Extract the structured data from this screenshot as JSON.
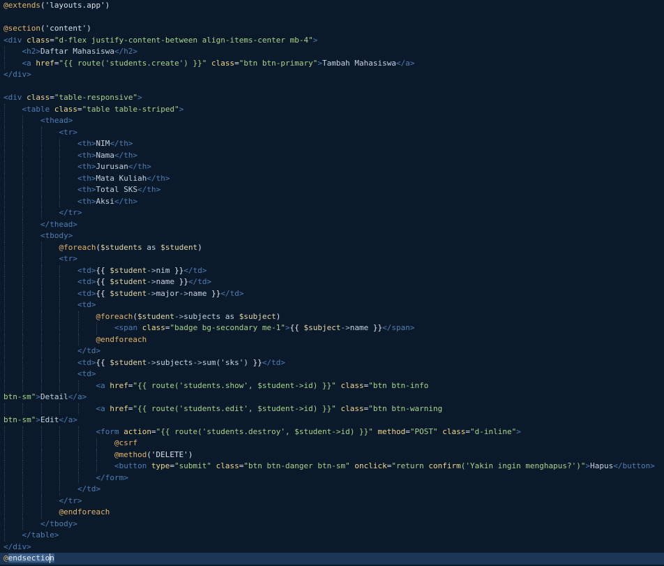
{
  "editor": {
    "colors": {
      "background": "#0b1a2b",
      "directive": "#e5b567",
      "tag": "#4d7fb5",
      "attribute": "#f0d78c",
      "string": "#a7d48a",
      "text": "#c7d2df",
      "current_line": "#1b3556"
    },
    "current_line_index": 48,
    "lines": [
      [
        [
          "directive",
          "@extends"
        ],
        [
          "punct",
          "('layouts.app')"
        ]
      ],
      [],
      [
        [
          "directive",
          "@section"
        ],
        [
          "punct",
          "('content')"
        ]
      ],
      [
        [
          "tag",
          "<div"
        ],
        [
          "text",
          " "
        ],
        [
          "attr",
          "class"
        ],
        [
          "punct",
          "="
        ],
        [
          "str",
          "\"d-flex justify-content-between align-items-center mb-4\""
        ],
        [
          "tag",
          ">"
        ]
      ],
      [
        [
          "text",
          "    "
        ],
        [
          "tag",
          "<h2>"
        ],
        [
          "text",
          "Daftar Mahasiswa"
        ],
        [
          "tag",
          "</h2>"
        ]
      ],
      [
        [
          "text",
          "    "
        ],
        [
          "tag",
          "<a"
        ],
        [
          "text",
          " "
        ],
        [
          "attr",
          "href"
        ],
        [
          "punct",
          "="
        ],
        [
          "str",
          "\"{{ route('students.create') }}\""
        ],
        [
          "text",
          " "
        ],
        [
          "attr",
          "class"
        ],
        [
          "punct",
          "="
        ],
        [
          "str",
          "\"btn btn-primary\""
        ],
        [
          "tag",
          ">"
        ],
        [
          "text",
          "Tambah Mahasiswa"
        ],
        [
          "tag",
          "</a>"
        ]
      ],
      [
        [
          "tag",
          "</div>"
        ]
      ],
      [],
      [
        [
          "tag",
          "<div"
        ],
        [
          "text",
          " "
        ],
        [
          "attr",
          "class"
        ],
        [
          "punct",
          "="
        ],
        [
          "str",
          "\"table-responsive\""
        ],
        [
          "tag",
          ">"
        ]
      ],
      [
        [
          "text",
          "    "
        ],
        [
          "tag",
          "<table"
        ],
        [
          "text",
          " "
        ],
        [
          "attr",
          "class"
        ],
        [
          "punct",
          "="
        ],
        [
          "str",
          "\"table table-striped\""
        ],
        [
          "tag",
          ">"
        ]
      ],
      [
        [
          "text",
          "        "
        ],
        [
          "tag",
          "<thead>"
        ]
      ],
      [
        [
          "text",
          "            "
        ],
        [
          "tag",
          "<tr>"
        ]
      ],
      [
        [
          "text",
          "                "
        ],
        [
          "tag",
          "<th>"
        ],
        [
          "text",
          "NIM"
        ],
        [
          "tag",
          "</th>"
        ]
      ],
      [
        [
          "text",
          "                "
        ],
        [
          "tag",
          "<th>"
        ],
        [
          "text",
          "Nama"
        ],
        [
          "tag",
          "</th>"
        ]
      ],
      [
        [
          "text",
          "                "
        ],
        [
          "tag",
          "<th>"
        ],
        [
          "text",
          "Jurusan"
        ],
        [
          "tag",
          "</th>"
        ]
      ],
      [
        [
          "text",
          "                "
        ],
        [
          "tag",
          "<th>"
        ],
        [
          "text",
          "Mata Kuliah"
        ],
        [
          "tag",
          "</th>"
        ]
      ],
      [
        [
          "text",
          "                "
        ],
        [
          "tag",
          "<th>"
        ],
        [
          "text",
          "Total SKS"
        ],
        [
          "tag",
          "</th>"
        ]
      ],
      [
        [
          "text",
          "                "
        ],
        [
          "tag",
          "<th>"
        ],
        [
          "text",
          "Aksi"
        ],
        [
          "tag",
          "</th>"
        ]
      ],
      [
        [
          "text",
          "            "
        ],
        [
          "tag",
          "</tr>"
        ]
      ],
      [
        [
          "text",
          "        "
        ],
        [
          "tag",
          "</thead>"
        ]
      ],
      [
        [
          "text",
          "        "
        ],
        [
          "tag",
          "<tbody>"
        ]
      ],
      [
        [
          "text",
          "            "
        ],
        [
          "directive",
          "@foreach"
        ],
        [
          "punct",
          "("
        ],
        [
          "var",
          "$students"
        ],
        [
          "text",
          " as "
        ],
        [
          "var",
          "$student"
        ],
        [
          "punct",
          ")"
        ]
      ],
      [
        [
          "text",
          "            "
        ],
        [
          "tag",
          "<tr>"
        ]
      ],
      [
        [
          "text",
          "                "
        ],
        [
          "tag",
          "<td>"
        ],
        [
          "echo",
          "{{ "
        ],
        [
          "var",
          "$student"
        ],
        [
          "op",
          "->"
        ],
        [
          "text",
          "nim"
        ],
        [
          "echo",
          " }}"
        ],
        [
          "tag",
          "</td>"
        ]
      ],
      [
        [
          "text",
          "                "
        ],
        [
          "tag",
          "<td>"
        ],
        [
          "echo",
          "{{ "
        ],
        [
          "var",
          "$student"
        ],
        [
          "op",
          "->"
        ],
        [
          "text",
          "name"
        ],
        [
          "echo",
          " }}"
        ],
        [
          "tag",
          "</td>"
        ]
      ],
      [
        [
          "text",
          "                "
        ],
        [
          "tag",
          "<td>"
        ],
        [
          "echo",
          "{{ "
        ],
        [
          "var",
          "$student"
        ],
        [
          "op",
          "->"
        ],
        [
          "text",
          "major"
        ],
        [
          "op",
          "->"
        ],
        [
          "text",
          "name"
        ],
        [
          "echo",
          " }}"
        ],
        [
          "tag",
          "</td>"
        ]
      ],
      [
        [
          "text",
          "                "
        ],
        [
          "tag",
          "<td>"
        ]
      ],
      [
        [
          "text",
          "                    "
        ],
        [
          "directive",
          "@foreach"
        ],
        [
          "punct",
          "("
        ],
        [
          "var",
          "$student"
        ],
        [
          "op",
          "->"
        ],
        [
          "text",
          "subjects as "
        ],
        [
          "var",
          "$subject"
        ],
        [
          "punct",
          ")"
        ]
      ],
      [
        [
          "text",
          "                        "
        ],
        [
          "tag",
          "<span"
        ],
        [
          "text",
          " "
        ],
        [
          "attr",
          "class"
        ],
        [
          "punct",
          "="
        ],
        [
          "str",
          "\"badge bg-secondary me-1\""
        ],
        [
          "tag",
          ">"
        ],
        [
          "echo",
          "{{ "
        ],
        [
          "var",
          "$subject"
        ],
        [
          "op",
          "->"
        ],
        [
          "text",
          "name"
        ],
        [
          "echo",
          " }}"
        ],
        [
          "tag",
          "</span>"
        ]
      ],
      [
        [
          "text",
          "                    "
        ],
        [
          "directive",
          "@endforeach"
        ]
      ],
      [
        [
          "text",
          "                "
        ],
        [
          "tag",
          "</td>"
        ]
      ],
      [
        [
          "text",
          "                "
        ],
        [
          "tag",
          "<td>"
        ],
        [
          "echo",
          "{{ "
        ],
        [
          "var",
          "$student"
        ],
        [
          "op",
          "->"
        ],
        [
          "text",
          "subjects"
        ],
        [
          "op",
          "->"
        ],
        [
          "text",
          "sum('sks')"
        ],
        [
          "echo",
          " }}"
        ],
        [
          "tag",
          "</td>"
        ]
      ],
      [
        [
          "text",
          "                "
        ],
        [
          "tag",
          "<td>"
        ]
      ],
      [
        [
          "text",
          "                    "
        ],
        [
          "tag",
          "<a"
        ],
        [
          "text",
          " "
        ],
        [
          "attr",
          "href"
        ],
        [
          "punct",
          "="
        ],
        [
          "str",
          "\"{{ route('students.show', $student->id) }}\""
        ],
        [
          "text",
          " "
        ],
        [
          "attr",
          "class"
        ],
        [
          "punct",
          "="
        ],
        [
          "str",
          "\"btn btn-info"
        ]
      ],
      [
        [
          "str",
          "btn-sm\""
        ],
        [
          "tag",
          ">"
        ],
        [
          "text",
          "Detail"
        ],
        [
          "tag",
          "</a>"
        ]
      ],
      [
        [
          "text",
          "                    "
        ],
        [
          "tag",
          "<a"
        ],
        [
          "text",
          " "
        ],
        [
          "attr",
          "href"
        ],
        [
          "punct",
          "="
        ],
        [
          "str",
          "\"{{ route('students.edit', $student->id) }}\""
        ],
        [
          "text",
          " "
        ],
        [
          "attr",
          "class"
        ],
        [
          "punct",
          "="
        ],
        [
          "str",
          "\"btn btn-warning"
        ]
      ],
      [
        [
          "str",
          "btn-sm\""
        ],
        [
          "tag",
          ">"
        ],
        [
          "text",
          "Edit"
        ],
        [
          "tag",
          "</a>"
        ]
      ],
      [
        [
          "text",
          "                    "
        ],
        [
          "tag",
          "<form"
        ],
        [
          "text",
          " "
        ],
        [
          "attr",
          "action"
        ],
        [
          "punct",
          "="
        ],
        [
          "str",
          "\"{{ route('students.destroy', $student->id) }}\""
        ],
        [
          "text",
          " "
        ],
        [
          "attr",
          "method"
        ],
        [
          "punct",
          "="
        ],
        [
          "str",
          "\"POST\""
        ],
        [
          "text",
          " "
        ],
        [
          "attr",
          "class"
        ],
        [
          "punct",
          "="
        ],
        [
          "str",
          "\"d-inline\""
        ],
        [
          "tag",
          ">"
        ]
      ],
      [
        [
          "text",
          "                        "
        ],
        [
          "directive",
          "@csrf"
        ]
      ],
      [
        [
          "text",
          "                        "
        ],
        [
          "directive",
          "@method"
        ],
        [
          "punct",
          "('DELETE')"
        ]
      ],
      [
        [
          "text",
          "                        "
        ],
        [
          "tag",
          "<button"
        ],
        [
          "text",
          " "
        ],
        [
          "attr",
          "type"
        ],
        [
          "punct",
          "="
        ],
        [
          "str",
          "\"submit\""
        ],
        [
          "text",
          " "
        ],
        [
          "attr",
          "class"
        ],
        [
          "punct",
          "="
        ],
        [
          "str",
          "\"btn btn-danger btn-sm\""
        ],
        [
          "text",
          " "
        ],
        [
          "attr",
          "onclick"
        ],
        [
          "punct",
          "="
        ],
        [
          "str",
          "\"return "
        ],
        [
          "attr",
          "confirm"
        ],
        [
          "str",
          "('Yakin ingin menghapus?')\""
        ],
        [
          "tag",
          ">"
        ],
        [
          "text",
          "Hapus"
        ],
        [
          "tag",
          "</button>"
        ]
      ],
      [
        [
          "text",
          "                    "
        ],
        [
          "tag",
          "</form>"
        ]
      ],
      [
        [
          "text",
          "                "
        ],
        [
          "tag",
          "</td>"
        ]
      ],
      [
        [
          "text",
          "            "
        ],
        [
          "tag",
          "</tr>"
        ]
      ],
      [
        [
          "text",
          "            "
        ],
        [
          "directive",
          "@endforeach"
        ]
      ],
      [
        [
          "text",
          "        "
        ],
        [
          "tag",
          "</tbody>"
        ]
      ],
      [
        [
          "text",
          "    "
        ],
        [
          "tag",
          "</table>"
        ]
      ],
      [
        [
          "tag",
          "</div>"
        ]
      ],
      [
        [
          "directive",
          "@"
        ],
        [
          "sel",
          "endsection"
        ]
      ]
    ]
  }
}
